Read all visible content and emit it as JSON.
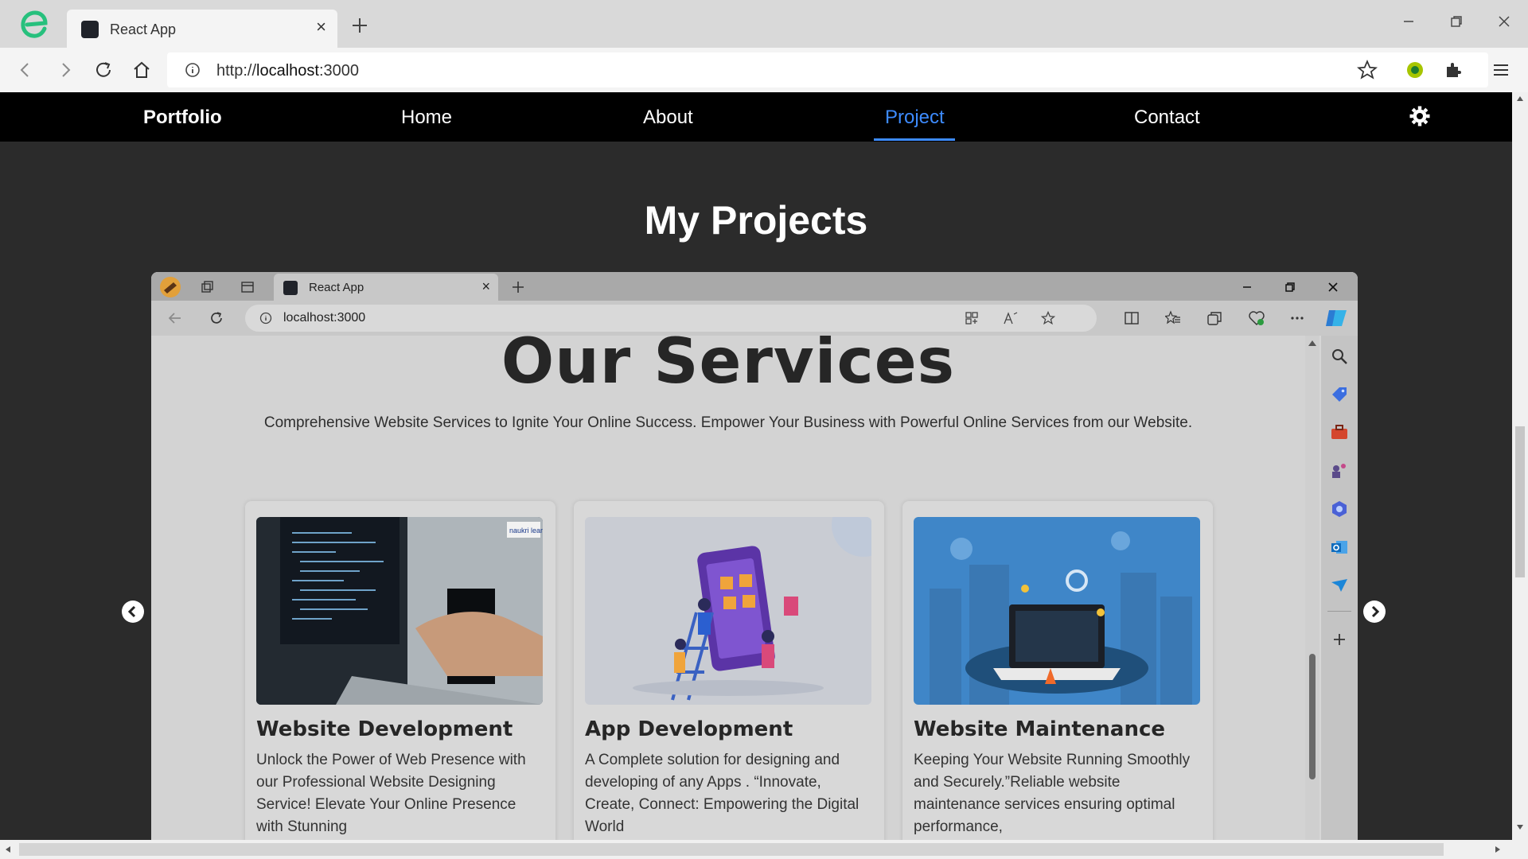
{
  "browser": {
    "tab_title": "React App",
    "url_scheme": "http://",
    "url_host": "localhost",
    "url_port": ":3000"
  },
  "nav": {
    "brand": "Portfolio",
    "links": [
      "Home",
      "About",
      "Project",
      "Contact"
    ],
    "active": "Project"
  },
  "section_title": "My Projects",
  "embedded": {
    "tab_title": "React App",
    "url_host": "localhost",
    "url_port": ":3000",
    "heading": "Our Services",
    "subheading": "Comprehensive Website Services to Ignite Your Online Success. Empower Your Business with Powerful Online Services from our Website.",
    "cards": [
      {
        "title": "Website Development",
        "text": "Unlock the Power of Web Presence with our Professional Website Designing Service! Elevate Your Online Presence with Stunning",
        "image_label": "naukri learning"
      },
      {
        "title": "App Development",
        "text": "A Complete solution for designing and developing of any Apps . “Innovate, Create, Connect: Empowering the Digital World"
      },
      {
        "title": "Website Maintenance",
        "text": "Keeping Your Website Running Smoothly and Securely.”Reliable website maintenance services ensuring optimal performance,"
      }
    ]
  },
  "colors": {
    "nav_bg": "#000000",
    "page_bg": "#2b2b2b",
    "accent": "#3d8bff"
  }
}
